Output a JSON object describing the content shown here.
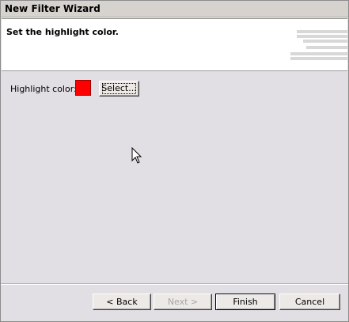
{
  "window": {
    "title": "New Filter Wizard"
  },
  "banner": {
    "heading": "Set the highlight color."
  },
  "form": {
    "highlight_label": "Highlight color:",
    "highlight_color": "#ff0000",
    "select_label": "Select..."
  },
  "buttons": {
    "back": "< Back",
    "next": "Next >",
    "finish": "Finish",
    "cancel": "Cancel"
  },
  "pointer": {
    "icon": "arrow-cursor-icon"
  }
}
